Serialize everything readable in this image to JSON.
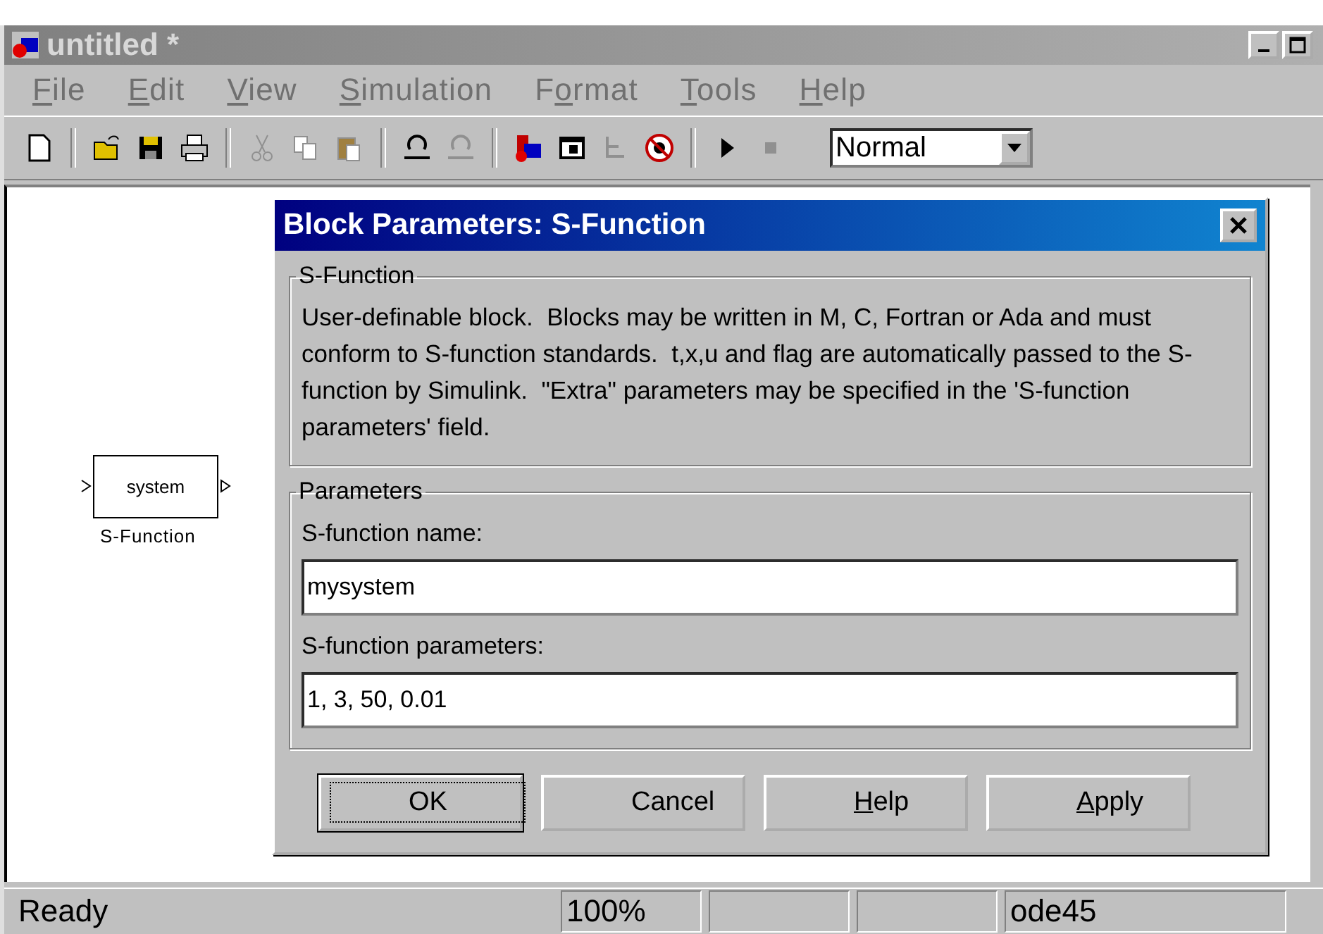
{
  "window": {
    "title": "untitled *",
    "active": false
  },
  "menu": [
    {
      "key": "F",
      "after": "ile"
    },
    {
      "key": "E",
      "after": "dit"
    },
    {
      "key": "V",
      "after": "iew"
    },
    {
      "key": "S",
      "after": "imulation"
    },
    {
      "before": "F",
      "key": "o",
      "after": "rmat"
    },
    {
      "key": "T",
      "after": "ools"
    },
    {
      "key": "H",
      "after": "elp"
    }
  ],
  "toolbar": [
    {
      "kind": "new",
      "disabled": false
    },
    {
      "kind": "separator"
    },
    {
      "kind": "open",
      "disabled": false
    },
    {
      "kind": "save",
      "disabled": false
    },
    {
      "kind": "print",
      "disabled": false
    },
    {
      "kind": "separator"
    },
    {
      "kind": "cut",
      "disabled": true
    },
    {
      "kind": "copy",
      "disabled": true
    },
    {
      "kind": "paste",
      "disabled": true
    },
    {
      "kind": "separator"
    },
    {
      "kind": "undo",
      "disabled": false
    },
    {
      "kind": "redo",
      "disabled": true
    },
    {
      "kind": "separator"
    },
    {
      "kind": "library",
      "disabled": false
    },
    {
      "kind": "browser",
      "disabled": false
    },
    {
      "kind": "hierarchy",
      "disabled": true
    },
    {
      "kind": "debug",
      "disabled": false
    },
    {
      "kind": "separator"
    },
    {
      "kind": "play",
      "disabled": false
    },
    {
      "kind": "stop",
      "disabled": true
    }
  ],
  "mode_select": {
    "value": "Normal"
  },
  "canvas": {
    "blocks": [
      {
        "text": "system",
        "label": "S-Function"
      }
    ]
  },
  "dialog": {
    "title": "Block Parameters: S-Function",
    "description_group": {
      "legend": "S-Function",
      "text": "User-definable block.  Blocks may be written in M, C, Fortran or Ada and must conform to S-function standards.  t,x,u and flag are automatically passed to the S-function by Simulink.  \"Extra\" parameters may be specified in the 'S-function parameters' field."
    },
    "parameters_group": {
      "legend": "Parameters",
      "fields": [
        {
          "label": "S-function name:",
          "value": "mysystem"
        },
        {
          "label": "S-function parameters:",
          "value": "1, 3, 50, 0.01"
        }
      ]
    },
    "buttons": [
      {
        "label": "OK",
        "default": true
      },
      {
        "label": "Cancel",
        "default": false
      },
      {
        "key": "H",
        "after": "elp",
        "default": false
      },
      {
        "key": "A",
        "after": "pply",
        "default": false
      }
    ]
  },
  "status_bar": {
    "message": "Ready",
    "panels": [
      {
        "kind": "text",
        "text": "100%"
      },
      {
        "kind": "empty"
      },
      {
        "kind": "empty"
      },
      {
        "kind": "text",
        "text": "ode45"
      }
    ]
  }
}
